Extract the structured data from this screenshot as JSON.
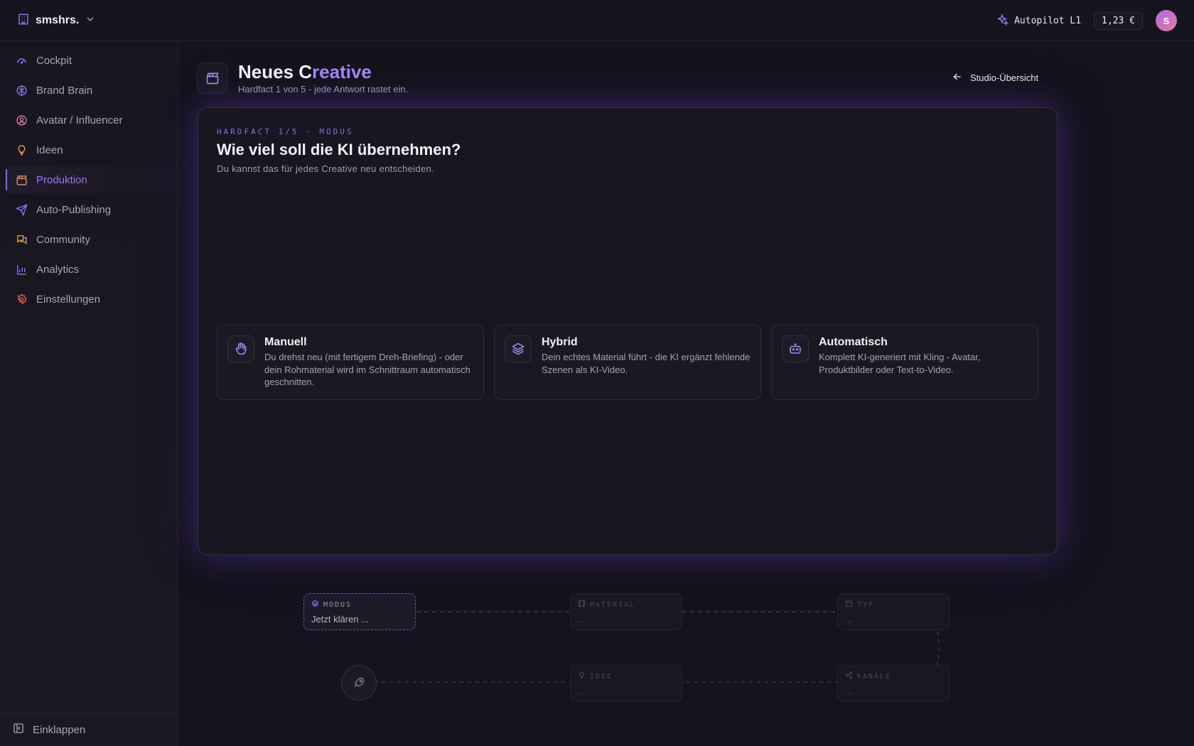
{
  "topbar": {
    "workspace_name": "smshrs.",
    "autopilot_label": "Autopilot L1",
    "balance": "1,23 €",
    "avatar_initial": "S"
  },
  "sidebar": {
    "items": [
      {
        "label": "Cockpit",
        "icon": "gauge-icon",
        "color": "#8f73e6"
      },
      {
        "label": "Brand Brain",
        "icon": "brain-icon",
        "color": "#8f73e6"
      },
      {
        "label": "Avatar / Influencer",
        "icon": "user-circle-icon",
        "color": "#e07aa8"
      },
      {
        "label": "Ideen",
        "icon": "lightbulb-icon",
        "color": "#d89a5a"
      },
      {
        "label": "Produktion",
        "icon": "clapperboard-icon",
        "color": "#e08a5a",
        "active": true
      },
      {
        "label": "Auto-Publishing",
        "icon": "send-icon",
        "color": "#8f73e6"
      },
      {
        "label": "Community",
        "icon": "chat-icon",
        "color": "#d89a5a"
      },
      {
        "label": "Analytics",
        "icon": "bar-chart-icon",
        "color": "#8f73e6"
      },
      {
        "label": "Einstellungen",
        "icon": "gear-icon",
        "color": "#e0604a"
      }
    ],
    "collapse_label": "Einklappen"
  },
  "header": {
    "title_main": "Neues C",
    "title_accent": "reative",
    "subtitle": "Hardfact 1 von 5 - jede Antwort rastet ein.",
    "back_label": "Studio-Übersicht"
  },
  "card": {
    "eyebrow": "HARDFACT 1/5 · MODUS",
    "question": "Wie viel soll die KI übernehmen?",
    "question_sub": "Du kannst das für jedes Creative neu entscheiden.",
    "options": [
      {
        "title": "Manuell",
        "desc": "Du drehst neu (mit fertigem Dreh-Briefing) - oder dein Rohmaterial wird im Schnittraum automatisch geschnitten.",
        "icon": "hand-icon"
      },
      {
        "title": "Hybrid",
        "desc": "Dein echtes Material führt - die KI ergänzt fehlende Szenen als KI-Video.",
        "icon": "layers-icon"
      },
      {
        "title": "Automatisch",
        "desc": "Komplett KI-generiert mit Kling - Avatar, Produktbilder oder Text-to-Video.",
        "icon": "bot-icon"
      }
    ]
  },
  "flow": {
    "nodes": [
      {
        "label": "MODUS",
        "value": "Jetzt klären ...",
        "icon": "layers-icon"
      },
      {
        "label": "MATERIAL",
        "value": "...",
        "icon": "film-icon"
      },
      {
        "label": "TYP",
        "value": "...",
        "icon": "clapperboard-icon"
      },
      {
        "label": "IDEE",
        "value": "...",
        "icon": "lightbulb-icon"
      },
      {
        "label": "KANÄLE",
        "value": "...",
        "icon": "share-icon"
      }
    ],
    "start_icon": "rocket-icon"
  },
  "colors": {
    "accent": "#9d77ec",
    "background": "#15131d",
    "card_border": "#34303f"
  }
}
